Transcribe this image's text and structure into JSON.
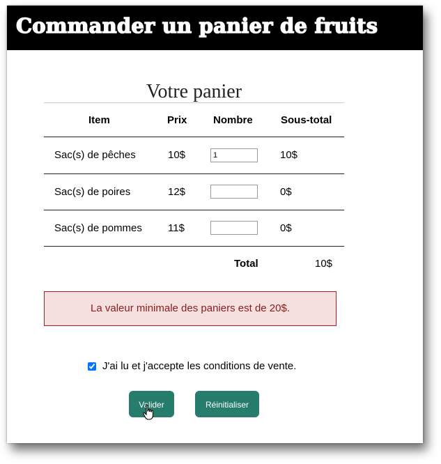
{
  "header": {
    "title": "Commander un panier de fruits"
  },
  "cart": {
    "caption": "Votre panier",
    "columns": [
      "Item",
      "Prix",
      "Nombre",
      "Sous-total"
    ],
    "rows": [
      {
        "item": "Sac(s) de pêches",
        "price": "10$",
        "quantity": "1",
        "subtotal": "10$"
      },
      {
        "item": "Sac(s) de poires",
        "price": "12$",
        "quantity": "",
        "subtotal": "0$"
      },
      {
        "item": "Sac(s) de pommes",
        "price": "11$",
        "quantity": "",
        "subtotal": "0$"
      }
    ],
    "total_label": "Total",
    "total_value": "10$"
  },
  "alert": {
    "message": "La valeur minimale des paniers est de 20$."
  },
  "terms": {
    "label": "J'ai lu et j'accepte les conditions de vente.",
    "checked": true
  },
  "buttons": {
    "submit": "Valider",
    "reset": "Réinitialiser"
  },
  "colors": {
    "banner": "#000000",
    "button": "#267d6c",
    "alert_bg": "#f6dfdf",
    "alert_border": "#a12222"
  }
}
